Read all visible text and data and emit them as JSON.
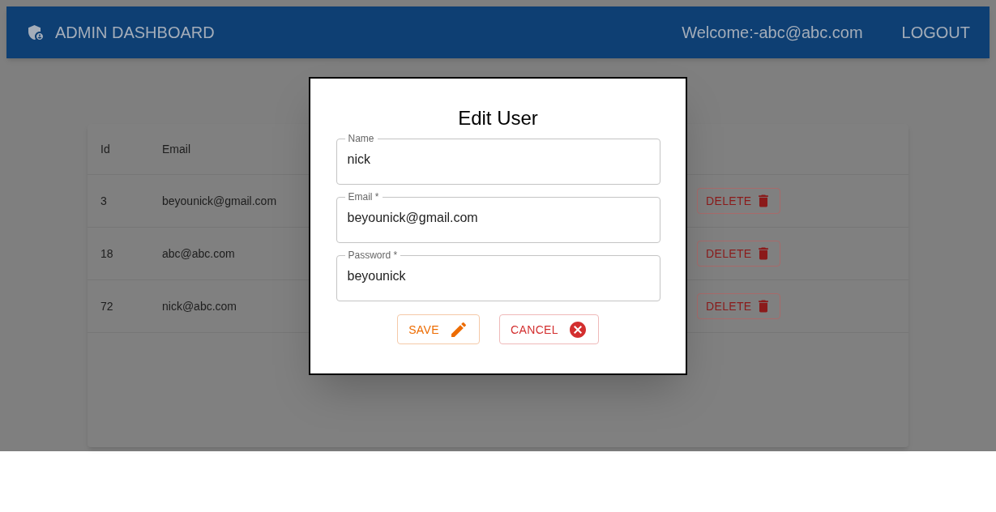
{
  "app_bar": {
    "title": "ADMIN DASHBOARD",
    "welcome": "Welcome:-abc@abc.com",
    "logout": "LOGOUT"
  },
  "table": {
    "columns": [
      "Id",
      "Email"
    ],
    "rows": [
      {
        "id": "3",
        "email": "beyounick@gmail.com",
        "action": "DELETE"
      },
      {
        "id": "18",
        "email": "abc@abc.com",
        "action": "DELETE"
      },
      {
        "id": "72",
        "email": "nick@abc.com",
        "action": "DELETE"
      }
    ]
  },
  "dialog": {
    "title": "Edit User",
    "fields": [
      {
        "label": "Name",
        "value": "nick"
      },
      {
        "label": "Email *",
        "value": "beyounick@gmail.com"
      },
      {
        "label": "Password *",
        "value": "beyounick"
      }
    ],
    "buttons": [
      {
        "label": "SAVE",
        "kind": "save"
      },
      {
        "label": "CANCEL",
        "kind": "cancel"
      }
    ]
  }
}
